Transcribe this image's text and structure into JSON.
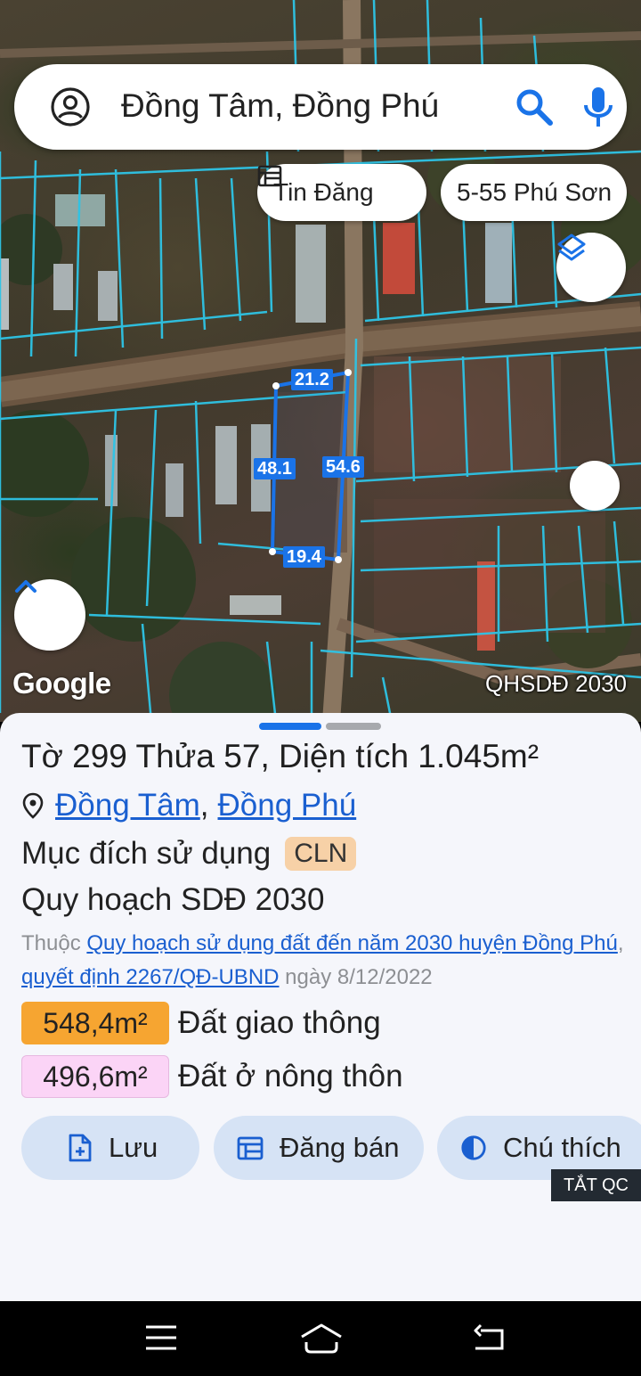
{
  "search": {
    "query": "Đồng Tâm, Đồng Phú"
  },
  "chips": {
    "tin_dang": "Tin Đăng",
    "address": "5-55 Phú Sơn"
  },
  "map": {
    "google": "Google",
    "layer_tag": "QHSDĐ 2030",
    "dims": {
      "top": "21.2",
      "left": "48.1",
      "right": "54.6",
      "bottom": "19.4"
    }
  },
  "sheet": {
    "title": "Tờ 299 Thửa 57, Diện tích 1.045m²",
    "location": {
      "commune": "Đồng Tâm",
      "separator": ",",
      "district": "Đồng Phú"
    },
    "purpose_label": "Mục đích sử dụng",
    "purpose_code": "CLN",
    "plan_title": "Quy hoạch SDĐ 2030",
    "plan_desc": {
      "prefix": "Thuộc ",
      "plan_link": "Quy hoạch sử dụng đất đến năm 2030 huyện Đồng Phú",
      "comma": ", ",
      "decision_link": "quyết định 2267/QĐ-UBND",
      "date": " ngày 8/12/2022"
    },
    "areas": [
      {
        "value": "548,4m²",
        "label": "Đất giao thông",
        "color": "#f6a531"
      },
      {
        "value": "496,6m²",
        "label": "Đất ở nông thôn",
        "color": "#fbd4f6"
      }
    ],
    "actions": {
      "save": "Lưu",
      "post": "Đăng bán",
      "legend": "Chú thích"
    },
    "ad_toggle": "TẮT QC"
  },
  "colors": {
    "accent": "#1a73e8",
    "parcel_lines": "#2ec4e6"
  },
  "icons": [
    "account-icon",
    "search-icon",
    "mic-icon",
    "calendar-icon",
    "layers-icon",
    "chevron-up-icon",
    "location-pin-icon",
    "file-add-icon",
    "contrast-icon",
    "menu-icon",
    "home-icon",
    "back-icon"
  ]
}
